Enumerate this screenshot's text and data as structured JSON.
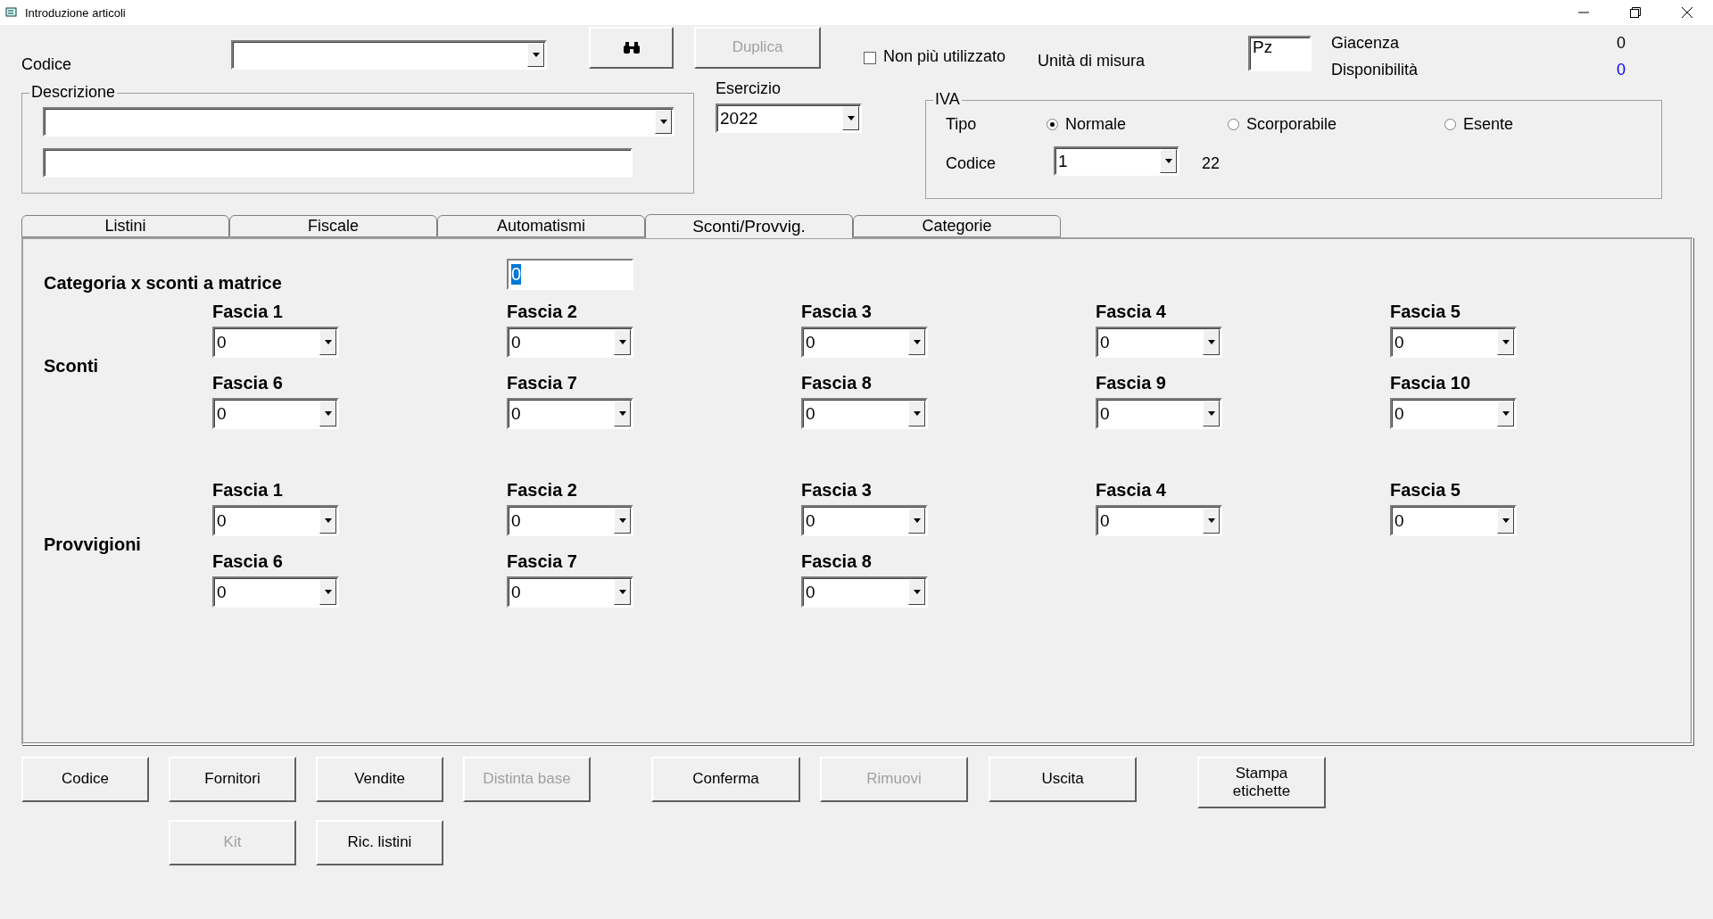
{
  "window": {
    "title": "Introduzione articoli"
  },
  "header": {
    "codice": {
      "label": "Codice"
    },
    "duplica": {
      "label": "Duplica",
      "disabled": true
    },
    "non_piu_utilizzato": {
      "label": "Non più utilizzato",
      "checked": false
    },
    "unita_di_misura": {
      "label": "Unità di misura",
      "value": "Pz"
    },
    "giacenza": {
      "label": "Giacenza",
      "value": "0"
    },
    "disponibilita": {
      "label": "Disponibilità",
      "value": "0"
    },
    "descrizione": {
      "legend": "Descrizione"
    },
    "esercizio": {
      "label": "Esercizio",
      "value": "2022"
    }
  },
  "iva": {
    "legend": "IVA",
    "tipo_label": "Tipo",
    "options": [
      {
        "label": "Normale",
        "selected": true
      },
      {
        "label": "Scorporabile",
        "selected": false
      },
      {
        "label": "Esente",
        "selected": false
      }
    ],
    "codice_label": "Codice",
    "codice_value": "1",
    "aliquota": "22"
  },
  "tabs": [
    {
      "label": "Listini",
      "selected": false
    },
    {
      "label": "Fiscale",
      "selected": false
    },
    {
      "label": "Automatismi",
      "selected": false
    },
    {
      "label": "Sconti/Provvig.",
      "selected": true
    },
    {
      "label": "Categorie",
      "selected": false
    }
  ],
  "panel": {
    "categoria": {
      "label": "Categoria x sconti a matrice",
      "value": "0"
    },
    "sections": [
      {
        "title": "Sconti",
        "fasce": [
          {
            "label": "Fascia 1",
            "value": "0"
          },
          {
            "label": "Fascia 2",
            "value": "0"
          },
          {
            "label": "Fascia 3",
            "value": "0"
          },
          {
            "label": "Fascia 4",
            "value": "0"
          },
          {
            "label": "Fascia 5",
            "value": "0"
          },
          {
            "label": "Fascia 6",
            "value": "0"
          },
          {
            "label": "Fascia 7",
            "value": "0"
          },
          {
            "label": "Fascia 8",
            "value": "0"
          },
          {
            "label": "Fascia 9",
            "value": "0"
          },
          {
            "label": "Fascia 10",
            "value": "0"
          }
        ]
      },
      {
        "title": "Provvigioni",
        "fasce": [
          {
            "label": "Fascia 1",
            "value": "0"
          },
          {
            "label": "Fascia 2",
            "value": "0"
          },
          {
            "label": "Fascia 3",
            "value": "0"
          },
          {
            "label": "Fascia 4",
            "value": "0"
          },
          {
            "label": "Fascia 5",
            "value": "0"
          },
          {
            "label": "Fascia 6",
            "value": "0"
          },
          {
            "label": "Fascia 7",
            "value": "0"
          },
          {
            "label": "Fascia 8",
            "value": "0"
          }
        ]
      }
    ]
  },
  "buttons": [
    [
      {
        "label": "Codice",
        "disabled": false
      },
      {
        "label": "Fornitori",
        "disabled": false
      },
      {
        "label": "Vendite",
        "disabled": false
      },
      {
        "label": "Distinta base",
        "disabled": true
      },
      {
        "label": "Conferma",
        "disabled": false
      },
      {
        "label": "Rimuovi",
        "disabled": true
      },
      {
        "label": "Uscita",
        "disabled": false
      },
      {
        "label": "Stampa etichette",
        "disabled": false
      }
    ],
    [
      {
        "label": "Kit",
        "disabled": true
      },
      {
        "label": "Ric. listini",
        "disabled": false
      }
    ]
  ]
}
